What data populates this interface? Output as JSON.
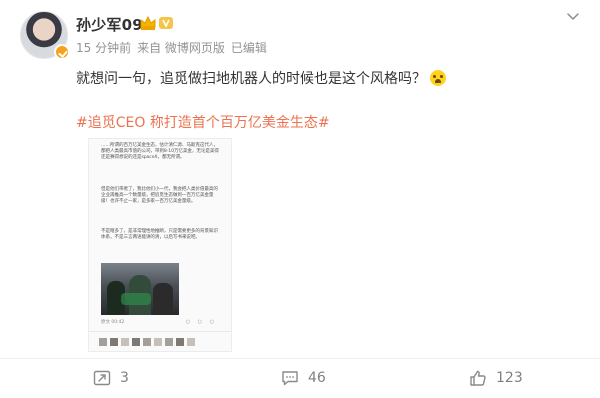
{
  "user": {
    "name": "孙少军09",
    "verified": true,
    "icons": [
      "vip-crown-icon",
      "level-badge-icon"
    ]
  },
  "meta": {
    "time": "15 分钟前",
    "source": "来自 微博网页版",
    "status": "已编辑"
  },
  "post": {
    "text": "就想问一句，追觅做扫地机器人的时候也是这个风格吗？",
    "emoji": "crying-face-icon",
    "topic": "#追觅CEO 称打造首个百万亿美金生态#"
  },
  "article": {
    "paragraph1": "……所谓的百万亿美金生态，估计清仁源、马斯克这代人，都把人类最高市值的公司，带到8-10万亿美金，无论是美得还是赛得想说的还是spaceX，都无所谓。",
    "paragraph2": "但是他们带者了，我比他们小一代，我会把人类价值最高的企业再推高一个数量级，把追觅生态做到一百万亿美金量级！也许不止一家，是多家一百万亿美金量级。",
    "paragraph3": "不是瞎多了，是非常理性地推断，只是需要更多的背景知识体系，不是三言两语能讲的清，以后写书来说吧。",
    "photo_meta": "原文 00:42",
    "photo_icons": "○ ○ ○"
  },
  "actions": {
    "repost_count": "3",
    "comment_count": "46",
    "like_count": "123"
  },
  "colors": {
    "topic": "#eb7350",
    "meta": "#939393",
    "action": "#808080",
    "verified_badge": "#f7a21b"
  }
}
